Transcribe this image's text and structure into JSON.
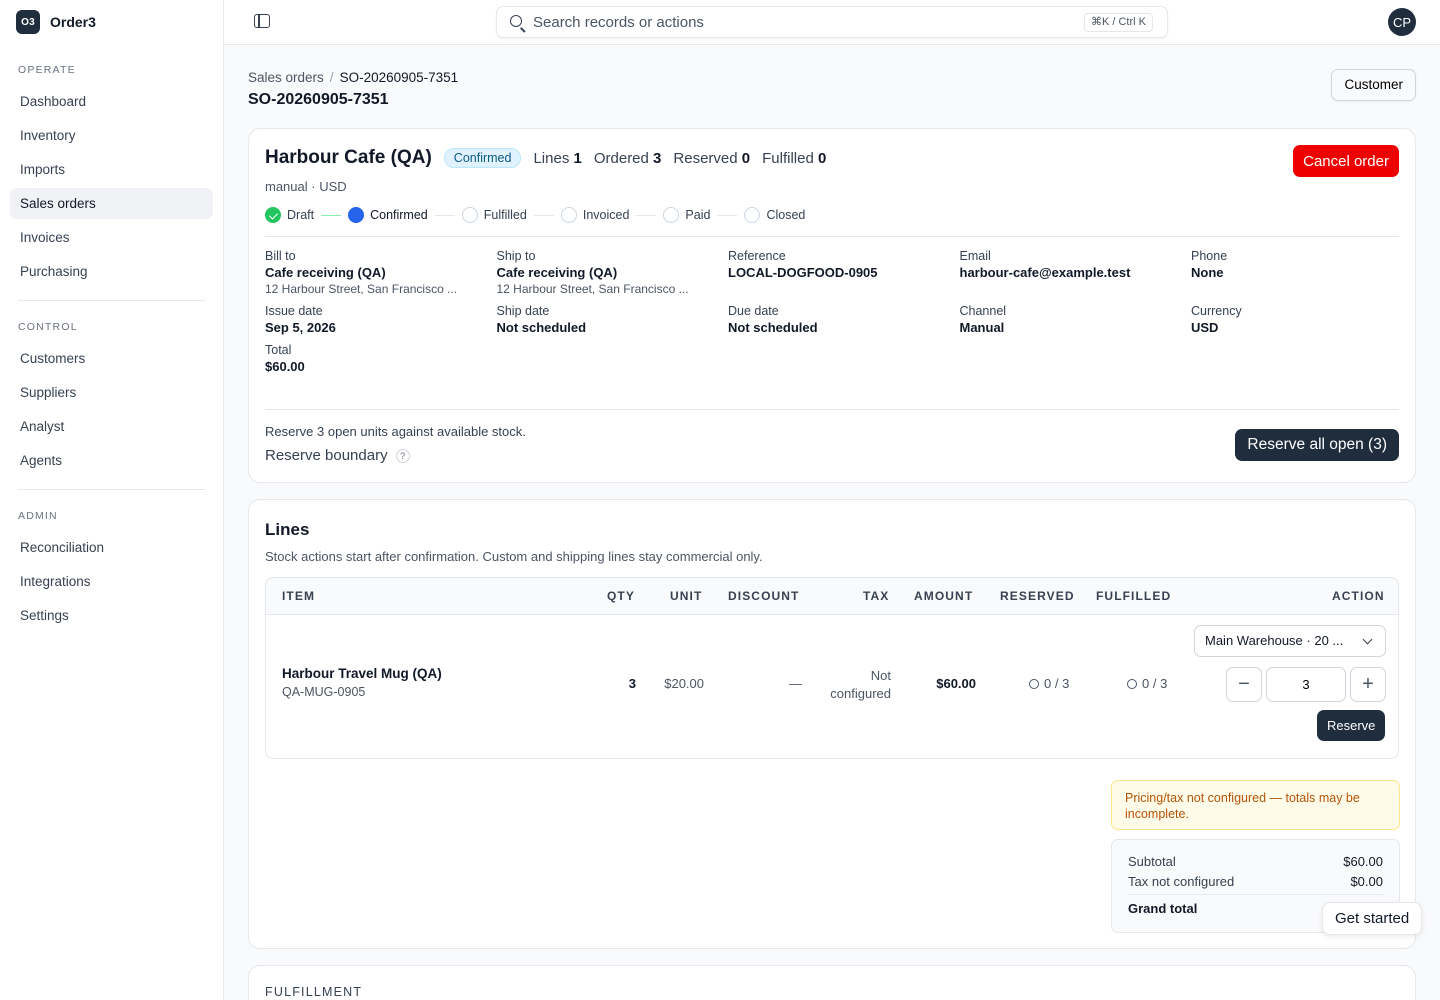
{
  "app": {
    "logo": "O3",
    "name": "Order3"
  },
  "nav": {
    "operate_heading": "OPERATE",
    "operate": [
      {
        "label": "Dashboard",
        "key": "dashboard"
      },
      {
        "label": "Inventory",
        "key": "inventory"
      },
      {
        "label": "Imports",
        "key": "imports"
      },
      {
        "label": "Sales orders",
        "key": "sales-orders"
      },
      {
        "label": "Invoices",
        "key": "invoices"
      },
      {
        "label": "Purchasing",
        "key": "purchasing"
      }
    ],
    "control_heading": "CONTROL",
    "control": [
      {
        "label": "Customers",
        "key": "customers"
      },
      {
        "label": "Suppliers",
        "key": "suppliers"
      },
      {
        "label": "Analyst",
        "key": "analyst"
      },
      {
        "label": "Agents",
        "key": "agents"
      }
    ],
    "admin_heading": "ADMIN",
    "admin": [
      {
        "label": "Reconciliation",
        "key": "reconciliation"
      },
      {
        "label": "Integrations",
        "key": "integrations"
      },
      {
        "label": "Settings",
        "key": "settings"
      }
    ],
    "active": "Sales orders"
  },
  "topbar": {
    "search_placeholder": "Search records or actions",
    "shortcut": "⌘K / Ctrl K",
    "avatar": "CP"
  },
  "breadcrumb": {
    "parent": "Sales orders",
    "separator": "/",
    "current": "SO-20260905-7351"
  },
  "page_title": "SO-20260905-7351",
  "customer_button": "Customer",
  "order": {
    "customer": "Harbour Cafe (QA)",
    "status": "Confirmed",
    "stats": [
      {
        "label": "Lines",
        "value": "1"
      },
      {
        "label": "Ordered",
        "value": "3"
      },
      {
        "label": "Reserved",
        "value": "0"
      },
      {
        "label": "Fulfilled",
        "value": "0"
      }
    ],
    "subline": "manual · USD",
    "cancel_label": "Cancel order",
    "steps": [
      {
        "label": "Draft",
        "state": "done"
      },
      {
        "label": "Confirmed",
        "state": "current"
      },
      {
        "label": "Fulfilled",
        "state": "pending"
      },
      {
        "label": "Invoiced",
        "state": "pending"
      },
      {
        "label": "Paid",
        "state": "pending"
      },
      {
        "label": "Closed",
        "state": "pending"
      }
    ],
    "details": {
      "bill_to": {
        "label": "Bill to",
        "value": "Cafe receiving (QA)",
        "extra": "12 Harbour Street, San Francisco ..."
      },
      "ship_to": {
        "label": "Ship to",
        "value": "Cafe receiving (QA)",
        "extra": "12 Harbour Street, San Francisco ..."
      },
      "reference": {
        "label": "Reference",
        "value": "LOCAL-DOGFOOD-0905"
      },
      "email": {
        "label": "Email",
        "value": "harbour-cafe@example.test"
      },
      "phone": {
        "label": "Phone",
        "value": "None"
      },
      "issue_date": {
        "label": "Issue date",
        "value": "Sep 5, 2026"
      },
      "ship_date": {
        "label": "Ship date",
        "value": "Not scheduled"
      },
      "due_date": {
        "label": "Due date",
        "value": "Not scheduled"
      },
      "channel": {
        "label": "Channel",
        "value": "Manual"
      },
      "currency": {
        "label": "Currency",
        "value": "USD"
      },
      "total": {
        "label": "Total",
        "value": "$60.00"
      }
    },
    "reserve_text": "Reserve 3 open units against available stock.",
    "reserve_boundary": "Reserve boundary",
    "help": "?",
    "reserve_all_label": "Reserve all open (3)"
  },
  "lines": {
    "title": "Lines",
    "subtitle": "Stock actions start after confirmation. Custom and shipping lines stay commercial only.",
    "columns": {
      "item": "ITEM",
      "qty": "QTY",
      "unit": "UNIT",
      "discount": "DISCOUNT",
      "tax": "TAX",
      "amount": "AMOUNT",
      "reserved": "RESERVED",
      "fulfilled": "FULFILLED",
      "action": "ACTION"
    },
    "rows": [
      {
        "item": "Harbour Travel Mug (QA)",
        "sku": "QA-MUG-0905",
        "qty": "3",
        "unit": "$20.00",
        "discount": "—",
        "tax_line1": "Not",
        "tax_line2": "configured",
        "amount": "$60.00",
        "reserved": "0 / 3",
        "fulfilled": "0 / 3",
        "warehouse": "Main Warehouse · 20 ...",
        "qty_input": "3",
        "minus": "−",
        "plus": "+",
        "reserve_label": "Reserve"
      }
    ],
    "warning": "Pricing/tax not configured — totals may be incomplete.",
    "totals": {
      "subtotal_label": "Subtotal",
      "subtotal": "$60.00",
      "tax_label": "Tax not configured",
      "tax": "$0.00",
      "grand_label": "Grand total"
    }
  },
  "fulfillment": {
    "title": "FULFILLMENT"
  },
  "get_started": "Get started",
  "colors": {
    "brand": "#1f2d3d",
    "danger": "#ef0000",
    "status_confirmed": "#0c5a80",
    "step_done": "#22c55e",
    "step_current": "#2563eb",
    "warning": "#b45309"
  }
}
